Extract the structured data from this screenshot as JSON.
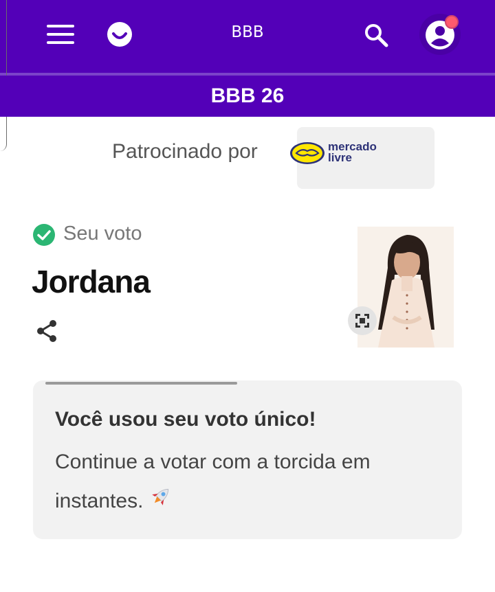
{
  "header": {
    "title": "BBB",
    "subtitle": "BBB 26",
    "menu_icon": "hamburger-icon",
    "logo_icon": "smile-logo-icon",
    "search_icon": "search-icon",
    "account_icon": "user-avatar-icon",
    "brand_color": "#5300b8"
  },
  "sponsor": {
    "label": "Patrocinado por",
    "brand_line1": "mercado",
    "brand_line2": "livre"
  },
  "vote": {
    "status_label": "Seu voto",
    "candidate": "Jordana",
    "check_color": "#2bb673"
  },
  "card": {
    "title": "Você usou seu voto único!",
    "body": "Continue a votar com a torcida em instantes."
  }
}
